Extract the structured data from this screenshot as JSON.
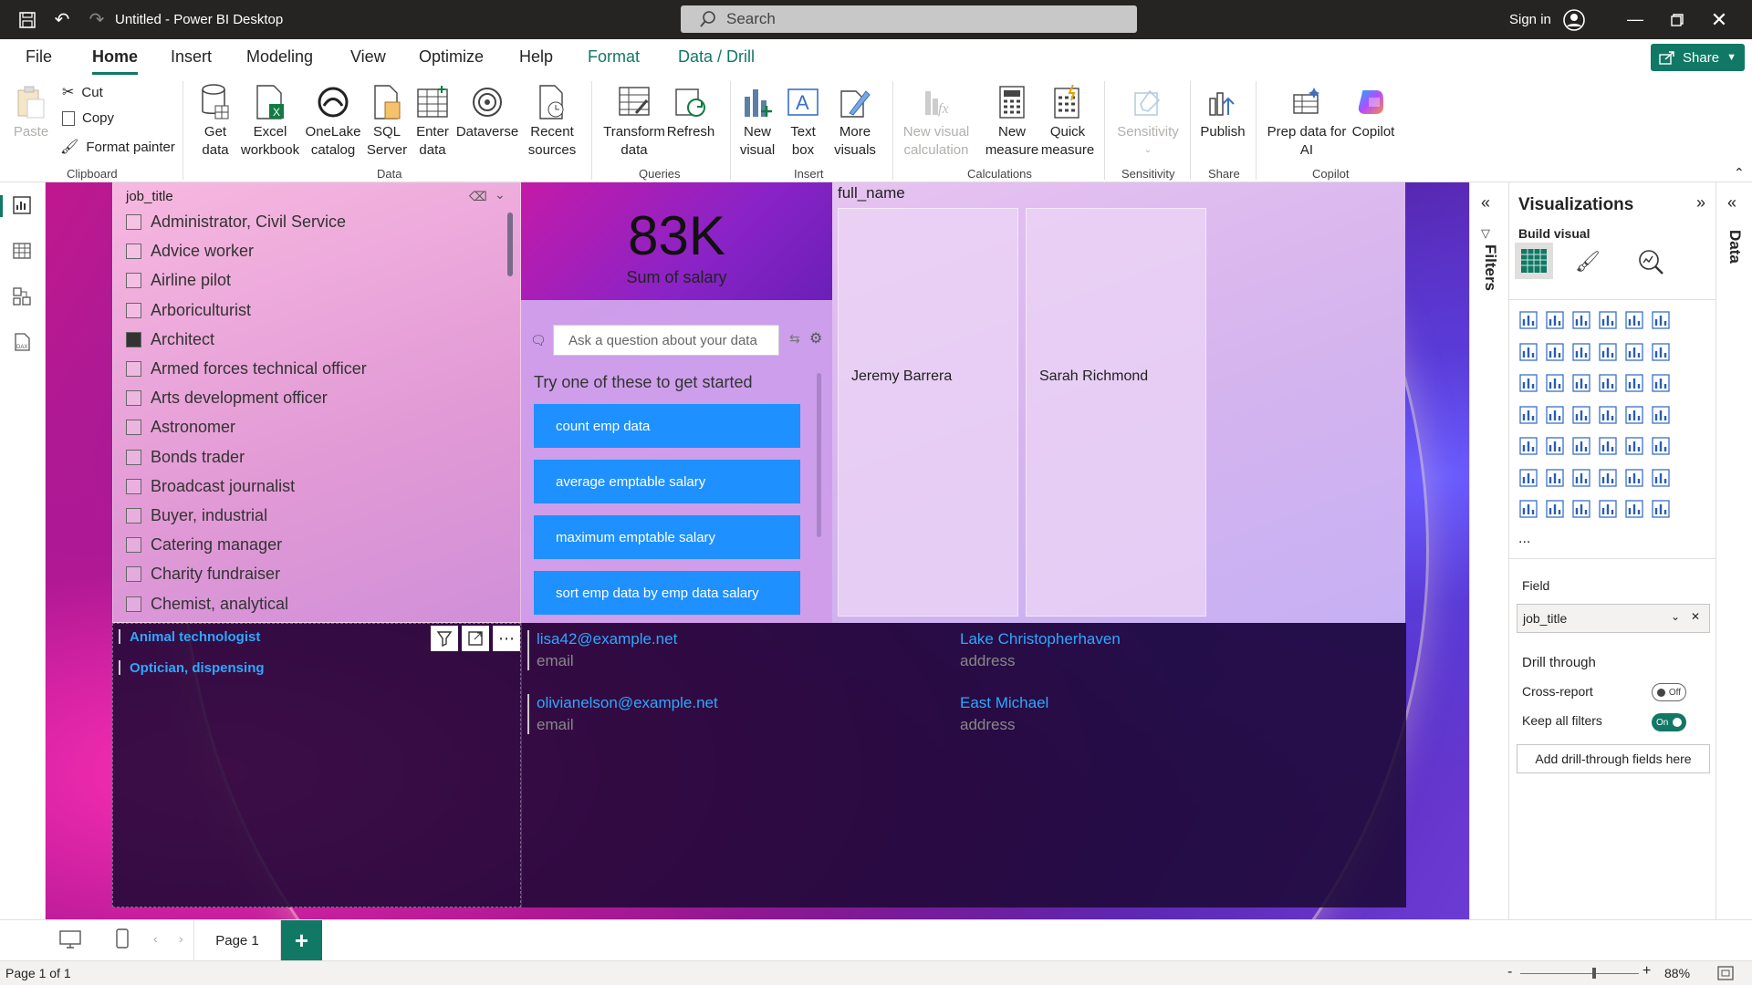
{
  "titlebar": {
    "title": "Untitled - Power BI Desktop",
    "search_placeholder": "Search",
    "sign_in": "Sign in"
  },
  "menu": {
    "tabs": [
      "File",
      "Home",
      "Insert",
      "Modeling",
      "View",
      "Optimize",
      "Help",
      "Format",
      "Data / Drill"
    ],
    "active": "Home",
    "share": "Share"
  },
  "ribbon": {
    "clipboard": {
      "paste": "Paste",
      "cut": "Cut",
      "copy": "Copy",
      "format_painter": "Format painter",
      "group": "Clipboard"
    },
    "data": {
      "get_data": [
        "Get",
        "data"
      ],
      "excel": [
        "Excel",
        "workbook"
      ],
      "onelake": [
        "OneLake",
        "catalog"
      ],
      "sql": [
        "SQL",
        "Server"
      ],
      "enter": [
        "Enter",
        "data"
      ],
      "dataverse": "Dataverse",
      "recent": [
        "Recent",
        "sources"
      ],
      "group": "Data"
    },
    "queries": {
      "transform": [
        "Transform",
        "data"
      ],
      "refresh": "Refresh",
      "group": "Queries"
    },
    "insert": {
      "new_visual": [
        "New",
        "visual"
      ],
      "text_box": [
        "Text",
        "box"
      ],
      "more_visuals": [
        "More",
        "visuals"
      ],
      "group": "Insert"
    },
    "calculations": {
      "new_visual_calc": [
        "New visual",
        "calculation"
      ],
      "new_measure": [
        "New",
        "measure"
      ],
      "quick_measure": [
        "Quick",
        "measure"
      ],
      "group": "Calculations"
    },
    "sensitivity": {
      "label": "Sensitivity",
      "group": "Sensitivity"
    },
    "share": {
      "publish": "Publish",
      "group": "Share"
    },
    "copilot": {
      "prep": [
        "Prep data for",
        "AI"
      ],
      "copilot": "Copilot",
      "group": "Copilot"
    }
  },
  "slicer": {
    "title": "job_title",
    "items": [
      "Administrator, Civil Service",
      "Advice worker",
      "Airline pilot",
      "Arboriculturist",
      "Architect",
      "Armed forces technical officer",
      "Arts development officer",
      "Astronomer",
      "Bonds trader",
      "Broadcast journalist",
      "Buyer, industrial",
      "Catering manager",
      "Charity fundraiser",
      "Chemist, analytical"
    ],
    "checked": "Architect"
  },
  "card": {
    "value": "83K",
    "label": "Sum of salary"
  },
  "qna": {
    "placeholder": "Ask a question about your data",
    "prompt": "Try one of these to get started",
    "suggestions": [
      "count emp data",
      "average emptable salary",
      "maximum emptable salary",
      "sort emp data by emp data salary"
    ]
  },
  "multirow": {
    "title": "full_name",
    "names": [
      "Jeremy Barrera",
      "Sarah Richmond"
    ]
  },
  "drill_list": {
    "items": [
      "Animal technologist",
      "Optician, dispensing"
    ]
  },
  "email_card": {
    "rows": [
      {
        "email": "lisa42@example.net",
        "email_label": "email",
        "address": "Lake Christopherhaven",
        "address_label": "address"
      },
      {
        "email": "olivianelson@example.net",
        "email_label": "email",
        "address": "East Michael",
        "address_label": "address"
      }
    ]
  },
  "filters_pane": {
    "label": "Filters"
  },
  "visualizations": {
    "title": "Visualizations",
    "build_visual": "Build visual",
    "field_label": "Field",
    "field_value": "job_title",
    "drill_through": "Drill through",
    "cross_report": "Cross-report",
    "cross_report_state": "Off",
    "keep_filters": "Keep all filters",
    "keep_filters_state": "On",
    "add_fields": "Add drill-through fields here",
    "more": "..."
  },
  "data_pane": {
    "label": "Data"
  },
  "pages": {
    "current": "Page 1",
    "add": "+"
  },
  "status": {
    "page_info": "Page 1 of 1",
    "zoom": "88%",
    "zoom_fraction": 0.88
  },
  "colors": {
    "accent": "#117865",
    "qna_button": "#1e90ff",
    "titlebar": "#252423"
  }
}
